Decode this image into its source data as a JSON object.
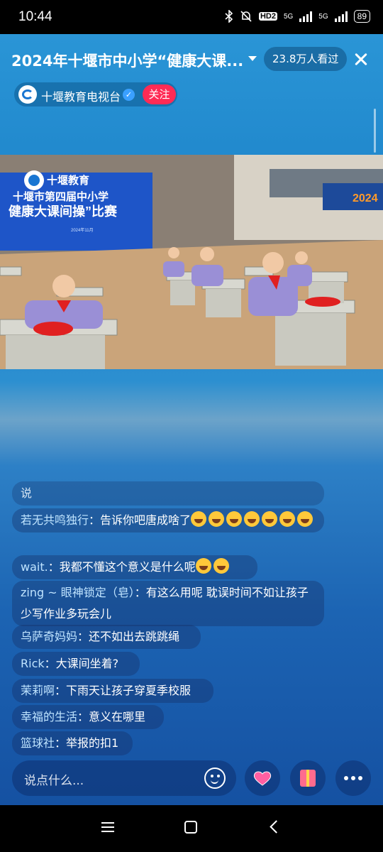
{
  "status_bar": {
    "time": "10:44",
    "network_1": "5G",
    "network_2": "5G",
    "hd_badge": "HD2",
    "battery": "89"
  },
  "header": {
    "title": "2024年十堰市中小学“健康大课...",
    "viewers": "23.8万人看过"
  },
  "channel": {
    "name": "十堰教育电视台",
    "follow_label": "关注"
  },
  "video": {
    "brand": "十堰教育",
    "banner_line1": "十堰市第四届中小学",
    "banner_line2": "健康大课间操”比赛",
    "banner_date": "2024年11月",
    "side_text": "2024"
  },
  "chat": {
    "partial": "说",
    "messages": [
      {
        "user": "若无共鸣独行",
        "text": "告诉你吧唐成啥了"
      },
      {
        "user": "wait.",
        "text": "我都不懂这个意义是什么呢"
      },
      {
        "user": "zing ~ 眼神锁定（皂）",
        "text": "有这么用呢 耽误时间不如让孩子少写作业多玩会儿"
      },
      {
        "user": "乌萨奇妈妈",
        "text": "还不如出去跳跳绳"
      },
      {
        "user": "Rick",
        "text": "大课间坐着?"
      },
      {
        "user": "茉莉啊",
        "text": "下雨天让孩子穿夏季校服"
      },
      {
        "user": "幸福的生活",
        "text": "意义在哪里"
      },
      {
        "user": "篮球社",
        "text": "举报的扣1"
      }
    ]
  },
  "input": {
    "placeholder": "说点什么..."
  },
  "colors": {
    "follow": "#ff2b55",
    "accent_blue": "#1e7fc4"
  }
}
